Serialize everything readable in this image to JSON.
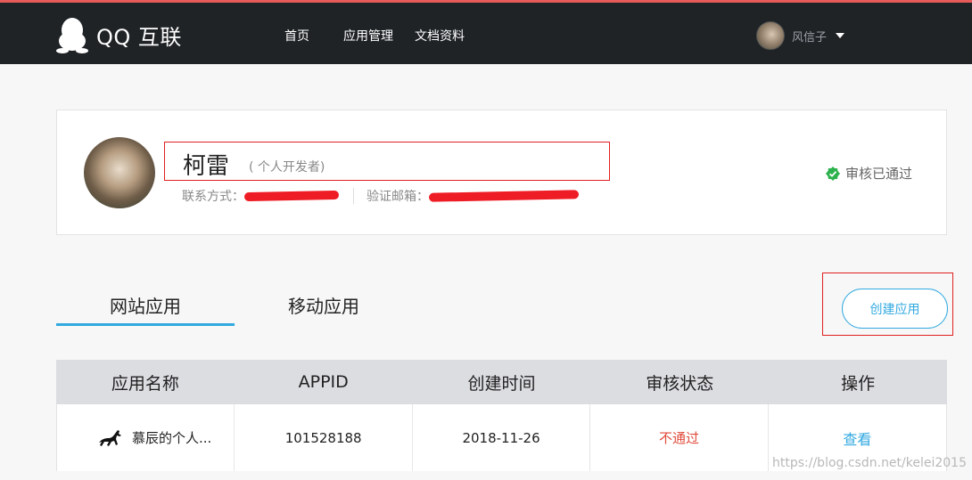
{
  "header": {
    "logo_text": "QQ 互联",
    "nav": [
      "首页",
      "应用管理",
      "文档资料"
    ],
    "user_name": "风信子"
  },
  "profile": {
    "name": "柯雷",
    "type": "( 个人开发者)",
    "contact_label": "联系方式：",
    "email_label": "验证邮箱：",
    "status": "审核已通过"
  },
  "tabs": [
    "网站应用",
    "移动应用"
  ],
  "create_button": "创建应用",
  "table": {
    "headers": [
      "应用名称",
      "APPID",
      "创建时间",
      "审核状态",
      "操作"
    ],
    "rows": [
      {
        "name": "慕辰的个人...",
        "appid": "101528188",
        "created": "2018-11-26",
        "status": "不通过",
        "action": "查看"
      }
    ]
  },
  "watermark": "https://blog.csdn.net/kelei2015",
  "colors": {
    "accent": "#32a9e0",
    "nav_bg": "#1f2326",
    "fail": "#e04a3a",
    "ok": "#2bb24c",
    "highlight_box": "#e02020"
  }
}
